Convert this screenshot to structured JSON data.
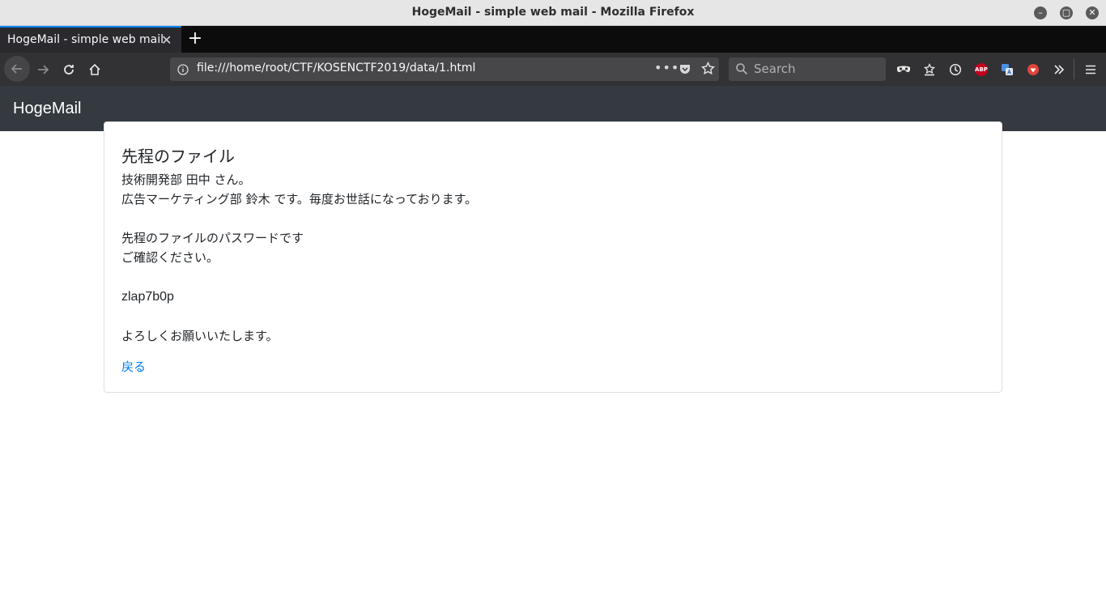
{
  "window": {
    "title": "HogeMail - simple web mail - Mozilla Firefox",
    "controls": [
      "minimize-icon",
      "maximize-icon",
      "close-icon"
    ]
  },
  "tabs": [
    {
      "label": "HogeMail - simple web mail",
      "active": true
    }
  ],
  "toolbar": {
    "url": "file:///home/root/CTF/KOSENCTF2019/data/1.html",
    "search_placeholder": "Search",
    "abp_label": "ABP",
    "icons": [
      "back-icon",
      "forward-icon",
      "reload-icon",
      "home-icon",
      "info-icon",
      "page-actions-icon",
      "pocket-icon",
      "bookmark-star-icon",
      "search-icon",
      "mask-icon",
      "library-icon",
      "history-icon",
      "adblock-icon",
      "translate-icon",
      "extension-icon",
      "overflow-icon",
      "menu-icon"
    ]
  },
  "site": {
    "brand": "HogeMail"
  },
  "mail": {
    "subject": "先程のファイル",
    "line1": "技術開発部 田中 さん。",
    "line2": "広告マーケティング部 鈴木 です。毎度お世話になっております。",
    "line3": "先程のファイルのパスワードです",
    "line4": "ご確認ください。",
    "password": "zlap7b0p",
    "line5": "よろしくお願いいたします。",
    "back_label": "戻る"
  },
  "colors": {
    "navbar_bg": "#343a40",
    "link": "#007bff",
    "tab_accent": "#0a84ff"
  }
}
